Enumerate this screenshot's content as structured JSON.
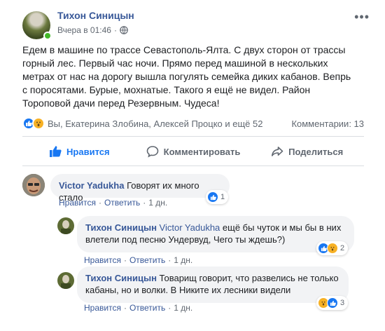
{
  "post": {
    "author": "Тихон Синицын",
    "timestamp": "Вчера в 01:46",
    "privacy_icon": "globe-icon",
    "more_icon": "more-icon",
    "text": "Едем в машине по трассе Севастополь-Ялта. С двух сторон от трассы горный лес. Первый час ночи. Прямо перед машиной в нескольких метрах от нас на дорогу вышла погулять семейка диких кабанов. Вепрь с поросятами. Бурые, мохнатые. Такого я ещё не видел. Район Тороповой дачи перед Резервным. Чудеса!",
    "reactions_text": "Вы, Екатерина Злобина, Алексей Процко и ещё 52",
    "comments_text": "Комментарии: 13"
  },
  "actions": {
    "like": "Нравится",
    "comment": "Комментировать",
    "share": "Поделиться"
  },
  "comments": [
    {
      "author": "Victor Yadukha",
      "mention": "",
      "text": "Говорят их много стало",
      "like_label": "Нравится",
      "reply_label": "Ответить",
      "time": "1 дн.",
      "reaction_count": "1"
    },
    {
      "author": "Тихон Синицын",
      "mention": "Victor Yadukha",
      "text": "ещё бы чуток и мы бы в них влетели под песню Ундервуд, Чего ты ждешь?)",
      "like_label": "Нравится",
      "reply_label": "Ответить",
      "time": "1 дн.",
      "reaction_count": "2"
    },
    {
      "author": "Тихон Синицын",
      "mention": "",
      "text": "Товарищ говорит, что развелись не только кабаны, но и волки. В Никите их лесники видели",
      "like_label": "Нравится",
      "reply_label": "Ответить",
      "time": "1 дн.",
      "reaction_count": "3"
    }
  ],
  "colors": {
    "link": "#385898",
    "accent": "#1877f2",
    "online": "#42b72a",
    "wow": "#f7b125"
  }
}
